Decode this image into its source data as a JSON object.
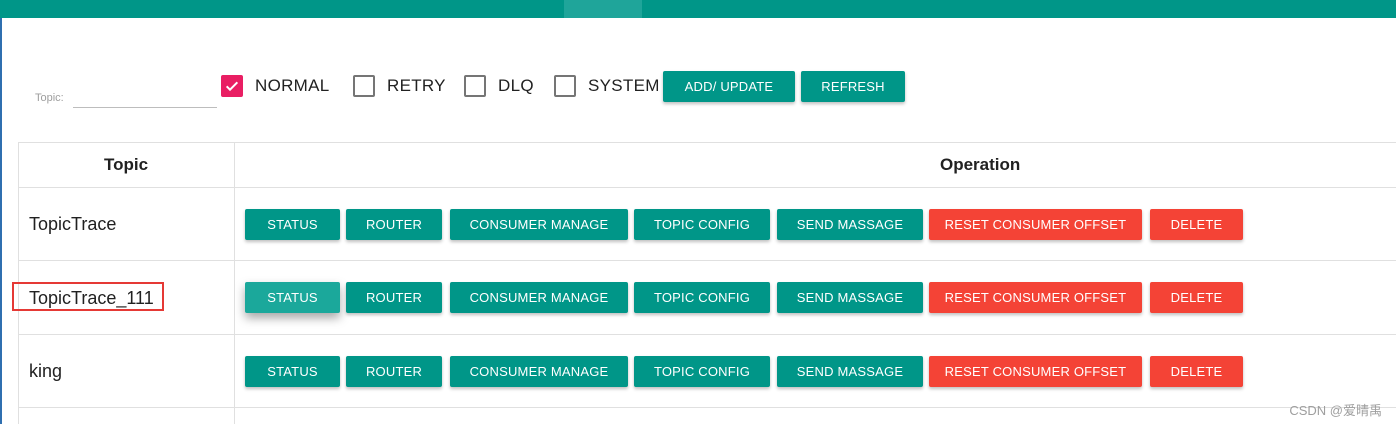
{
  "filter": {
    "topic_label": "Topic:",
    "topic_value": "",
    "checkboxes": [
      {
        "label": "NORMAL",
        "checked": true
      },
      {
        "label": "RETRY",
        "checked": false
      },
      {
        "label": "DLQ",
        "checked": false
      },
      {
        "label": "SYSTEM",
        "checked": false
      }
    ],
    "add_update_label": "ADD/ UPDATE",
    "refresh_label": "REFRESH"
  },
  "table": {
    "headers": {
      "topic": "Topic",
      "operation": "Operation"
    },
    "rows": [
      {
        "topic": "TopicTrace"
      },
      {
        "topic": "TopicTrace_111"
      },
      {
        "topic": "king"
      }
    ],
    "actions": {
      "status": "STATUS",
      "router": "ROUTER",
      "consumer_manage": "CONSUMER MANAGE",
      "topic_config": "TOPIC CONFIG",
      "send_message": "SEND MASSAGE",
      "reset_offset": "RESET CONSUMER OFFSET",
      "delete": "DELETE"
    }
  },
  "colors": {
    "primary": "#009688",
    "danger": "#f44336",
    "checkbox_checked": "#e91e63",
    "highlight": "#e53935"
  },
  "watermark": "CSDN @爱晴禹"
}
